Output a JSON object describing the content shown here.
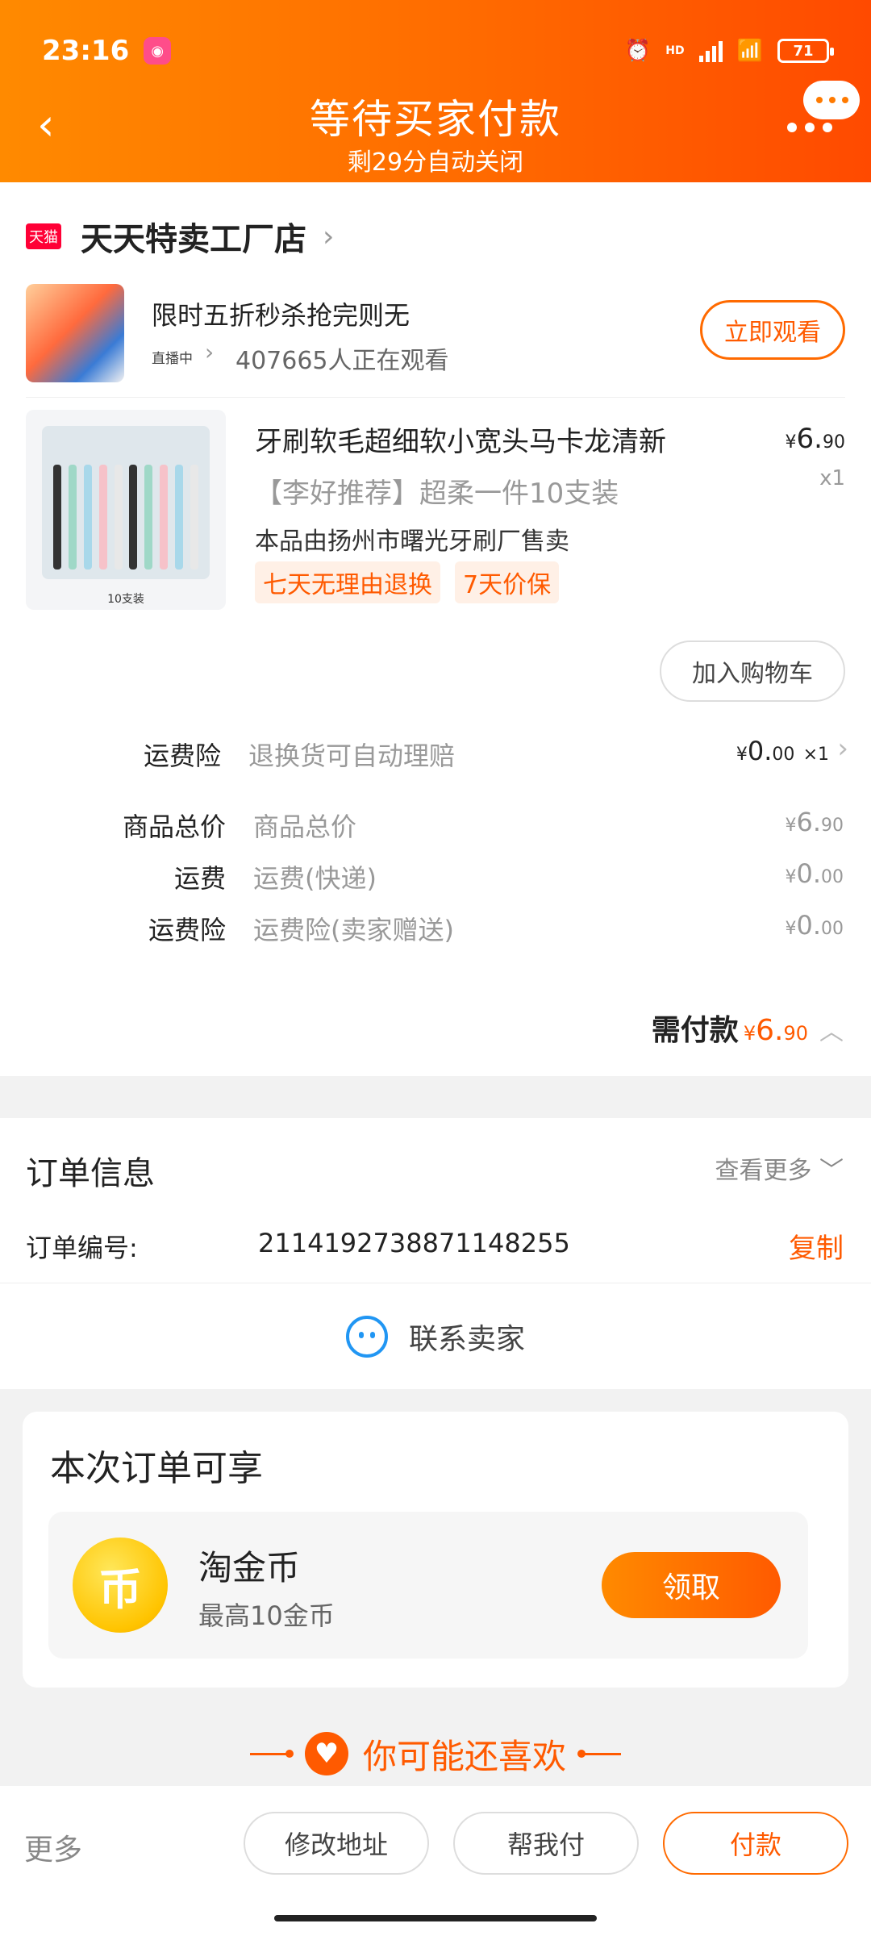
{
  "status_bar": {
    "time": "23:16",
    "hd": "HD",
    "battery": "71"
  },
  "header": {
    "title": "等待买家付款",
    "subtitle": "剩29分自动关闭"
  },
  "shop": {
    "badge": "天猫",
    "name": "天天特卖工厂店"
  },
  "live": {
    "title": "限时五折秒杀抢完则无",
    "tag": "直播中",
    "viewers": "407665人正在观看",
    "watch_label": "立即观看"
  },
  "product": {
    "title": "牙刷软毛超细软小宽头马卡龙清新",
    "subtitle": "【李好推荐】超柔一件10支装",
    "seller": "本品由扬州市曙光牙刷厂售卖",
    "tags": [
      "七天无理由退换",
      "7天价保"
    ],
    "price_yen": "¥",
    "price_int": "6.",
    "price_dec": "90",
    "qty": "x1",
    "pack_label": "10支装",
    "add_cart": "加入购物车"
  },
  "insurance": {
    "label": "运费险",
    "desc": "退换货可自动理赔",
    "yen": "¥",
    "int": "0.",
    "dec": "00",
    "qty": "×1"
  },
  "fees": [
    {
      "label": "商品总价",
      "desc": "商品总价",
      "yen": "¥",
      "int": "6.",
      "dec": "90"
    },
    {
      "label": "运费",
      "desc": "运费(快递)",
      "yen": "¥",
      "int": "0.",
      "dec": "00"
    },
    {
      "label": "运费险",
      "desc": "运费险(卖家赠送)",
      "yen": "¥",
      "int": "0.",
      "dec": "00"
    }
  ],
  "total": {
    "label": "需付款",
    "yen": "¥",
    "int": "6.",
    "dec": "90"
  },
  "order": {
    "title": "订单信息",
    "see_more": "查看更多",
    "no_label": "订单编号:",
    "no": "2114192738871148255",
    "copy": "复制",
    "contact": "联系卖家"
  },
  "benefits": {
    "title": "本次订单可享",
    "coin_name": "淘金币",
    "coin_desc": "最高10金币",
    "coin_glyph": "币",
    "claim": "领取"
  },
  "recommend": {
    "label": "你可能还喜欢"
  },
  "bottom": {
    "more": "更多",
    "change_address": "修改地址",
    "help_pay": "帮我付",
    "pay": "付款"
  },
  "colors": {
    "accent": "#ff5a00",
    "header_start": "#ff8a00",
    "header_end": "#ff4a00",
    "tmall": "#ff0036"
  }
}
